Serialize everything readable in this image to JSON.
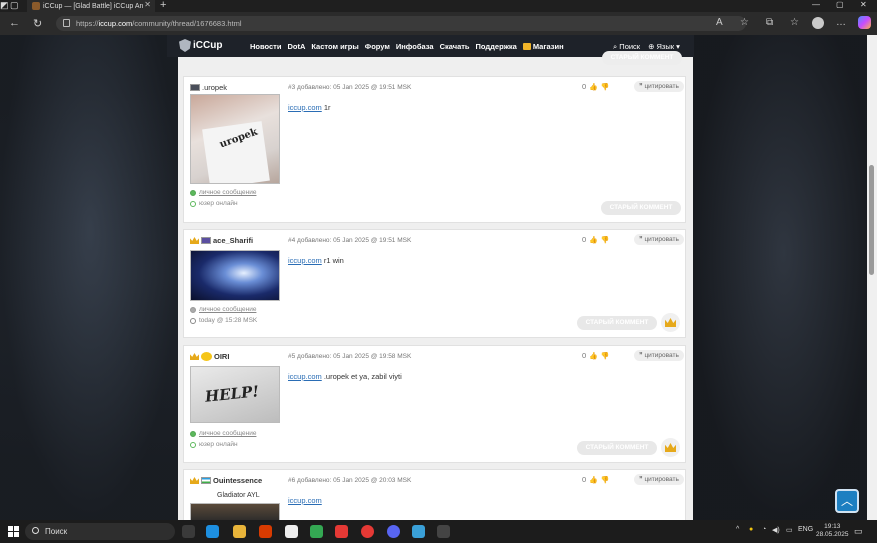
{
  "browser": {
    "tab_title": "iCCup — [Glad Battle] iCCup An",
    "url_prefix": "https://",
    "url_host": "iccup.com",
    "url_path": "/community/thread/1676683.html"
  },
  "site": {
    "logo": "iCCup",
    "nav": [
      "Новости",
      "DotA",
      "Кастом игры",
      "Форум",
      "Инфобаза",
      "Скачать",
      "Поддержка",
      "Магазин"
    ],
    "search": "Поиск",
    "language": "Язык"
  },
  "posts": [
    {
      "username": ".uropek",
      "meta": "#3 добавлено: 05 Jan 2025 @ 19:51 MSK",
      "votes": "0",
      "quote": "цитировать",
      "link": "iccup.com",
      "text": " 1r",
      "pm": "личное сообщение",
      "presence": "юзер онлайн",
      "old_comment": "СТАРЫЙ КОММЕНТ"
    },
    {
      "username": "ace_Sharifi",
      "meta": "#4 добавлено: 05 Jan 2025 @ 19:51 MSK",
      "votes": "0",
      "quote": "цитировать",
      "link": "iccup.com",
      "text": " r1 win",
      "pm": "личное сообщение",
      "presence": "today @ 15:28 MSK",
      "old_comment": "СТАРЫЙ КОММЕНТ"
    },
    {
      "username": "OIRI",
      "meta": "#5 добавлено: 05 Jan 2025 @ 19:58 MSK",
      "votes": "0",
      "quote": "цитировать",
      "link": "iccup.com",
      "text": " .uropek et ya, zabil viyti",
      "pm": "личное сообщение",
      "presence": "юзер онлайн",
      "old_comment": "СТАРЫЙ КОММЕНТ",
      "avatar_text": "HELP!"
    },
    {
      "username": "Ouintessence",
      "rank": "Gladiator AYL",
      "meta": "#6 добавлено: 05 Jan 2025 @ 20:03 MSK",
      "votes": "0",
      "quote": "цитировать",
      "link": "iccup.com"
    }
  ],
  "prev_old_comment": "СТАРЫЙ КОММЕНТ",
  "avatar1_text": "uropek",
  "taskbar": {
    "search": "Поиск",
    "lang": "ENG",
    "time": "19:13",
    "date": "28.05.2025"
  }
}
